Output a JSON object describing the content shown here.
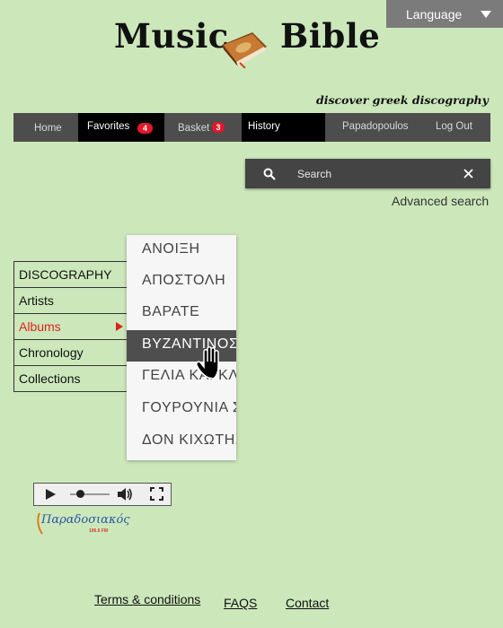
{
  "language": {
    "label": "Language"
  },
  "logo": {
    "word1": "Music",
    "word2": "Bible",
    "tagline": "discover greek discography"
  },
  "nav": {
    "home": "Home",
    "favorites": "Favorites",
    "favorites_count": "4",
    "basket": "Basket",
    "basket_count": "3",
    "history": "History",
    "user": "Papadopoulos",
    "logout": "Log Out"
  },
  "search": {
    "placeholder": "Search",
    "advanced": "Advanced search"
  },
  "sidemenu": {
    "items": [
      {
        "label": "DISCOGRAPHY"
      },
      {
        "label": "Artists"
      },
      {
        "label": "Albums"
      },
      {
        "label": "Chronology"
      },
      {
        "label": "Collections"
      }
    ]
  },
  "albums_dropdown": {
    "items": [
      {
        "label": "ΑΝΟΙΞΗ"
      },
      {
        "label": "ΑΠΟΣΤΟΛΗ"
      },
      {
        "label": "ΒΑΡΑΤΕ"
      },
      {
        "label": "ΒΥΖΑΝΤΙΝΟΣ"
      },
      {
        "label": "ΓΕΛΙΑ ΚΑΙ ΚΛ"
      },
      {
        "label": "ΓΟΥΡΟΥΝΙΑ Σ"
      },
      {
        "label": "ΔΟΝ ΚΙΧΩΤΗΣ"
      }
    ],
    "selected": "ΒΥΖΑΝΤΙΝΟΣ"
  },
  "player": {
    "icons": [
      "play-icon",
      "volume-icon",
      "fullscreen-icon"
    ],
    "progress": 0.25
  },
  "radio_logo": {
    "name": "Παραδοσιακός",
    "freq": "106.6 FM"
  },
  "footer": {
    "terms": "Terms & conditions",
    "faqs": "FAQS",
    "contact": "Contact"
  }
}
